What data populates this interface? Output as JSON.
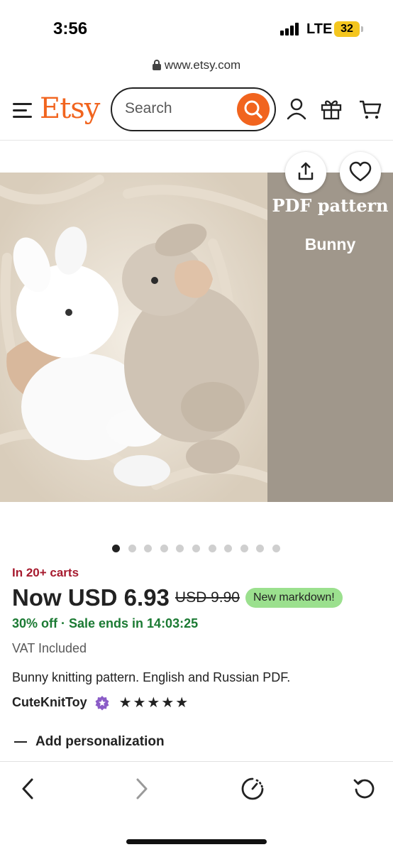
{
  "status_bar": {
    "time": "3:56",
    "network": "LTE",
    "battery": "32"
  },
  "url": "www.etsy.com",
  "header": {
    "logo": "Etsy",
    "search_placeholder": "Search"
  },
  "hero": {
    "banner_title": "PDF pattern",
    "banner_subtitle": "Bunny",
    "image_count": 11,
    "active_index": 0
  },
  "listing": {
    "carts": "In 20+ carts",
    "price_now": "Now USD 6.93",
    "price_old": "USD 9.90",
    "markdown_badge": "New markdown!",
    "sale_text": "30% off · Sale ends in 14:03:25",
    "vat": "VAT Included",
    "description": "Bunny knitting pattern. English and Russian PDF.",
    "shop": "CuteKnitToy",
    "rating_stars": "★★★★★",
    "rating": 5,
    "personalization": "Add personalization"
  },
  "colors": {
    "brand": "#f1641e",
    "markdown_badge": "#9be08e",
    "sale_green": "#1b7a33",
    "carts_red": "#a61a2e",
    "banner_bg": "#a0978b"
  }
}
